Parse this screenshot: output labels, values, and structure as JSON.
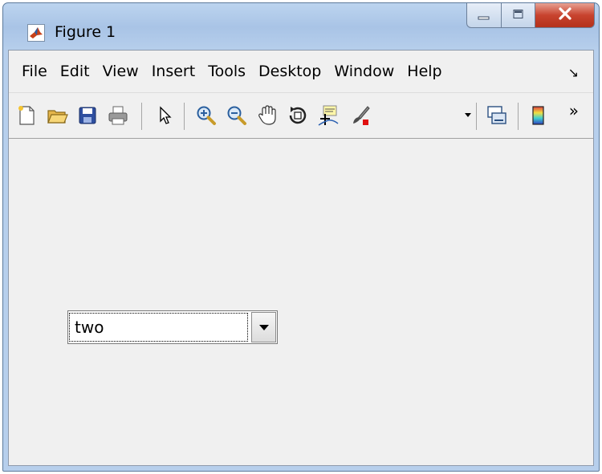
{
  "window": {
    "title": "Figure 1",
    "icon": "matlab-logo-icon",
    "caption_buttons": [
      "minimize-icon",
      "maximize-icon",
      "close-icon"
    ]
  },
  "menubar": {
    "items": [
      "File",
      "Edit",
      "View",
      "Insert",
      "Tools",
      "Desktop",
      "Window",
      "Help"
    ],
    "overflow_glyph": "↘"
  },
  "toolbar": {
    "buttons": [
      "new-figure-icon",
      "open-file-icon",
      "save-icon",
      "print-icon",
      "edit-plot-arrow-icon",
      "zoom-in-icon",
      "zoom-out-icon",
      "pan-hand-icon",
      "rotate-3d-icon",
      "data-cursor-icon",
      "brush-icon",
      "link-plot-icon",
      "colorbar-icon"
    ],
    "overflow_glyph": "»"
  },
  "popup_menu": {
    "selected_value": "two"
  },
  "colors": {
    "titlebar": "#b7cfec",
    "client_background": "#f0f0f0",
    "close_button": "#c8432e"
  }
}
